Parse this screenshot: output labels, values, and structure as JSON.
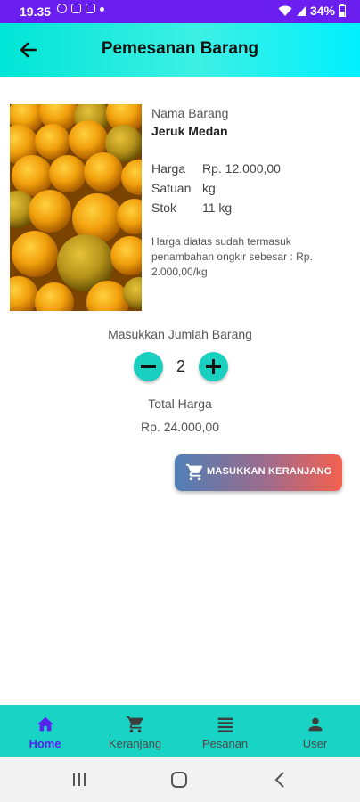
{
  "status_bar": {
    "time": "19.35",
    "battery": "34%"
  },
  "appbar": {
    "title": "Pemesanan Barang"
  },
  "product": {
    "name_label": "Nama Barang",
    "name": "Jeruk Medan",
    "price_label": "Harga",
    "price": "Rp. 12.000,00",
    "unit_label": "Satuan",
    "unit": "kg",
    "stock_label": "Stok",
    "stock": "11 kg",
    "note": "Harga diatas sudah termasuk penambahan ongkir sebesar : Rp. 2.000,00/kg"
  },
  "order": {
    "qty_label": "Masukkan Jumlah Barang",
    "qty": "2",
    "total_label": "Total Harga",
    "total": "Rp. 24.000,00",
    "add_button": "MASUKKAN KERANJANG"
  },
  "nav": {
    "items": [
      {
        "label": "Home",
        "icon": "home-icon",
        "active": true
      },
      {
        "label": "Keranjang",
        "icon": "cart-icon"
      },
      {
        "label": "Pesanan",
        "icon": "list-icon"
      },
      {
        "label": "User",
        "icon": "user-icon"
      }
    ]
  },
  "colors": {
    "status_bar": "#6a1ff0",
    "accent": "#19d3c4",
    "active_nav": "#5a22f0"
  }
}
